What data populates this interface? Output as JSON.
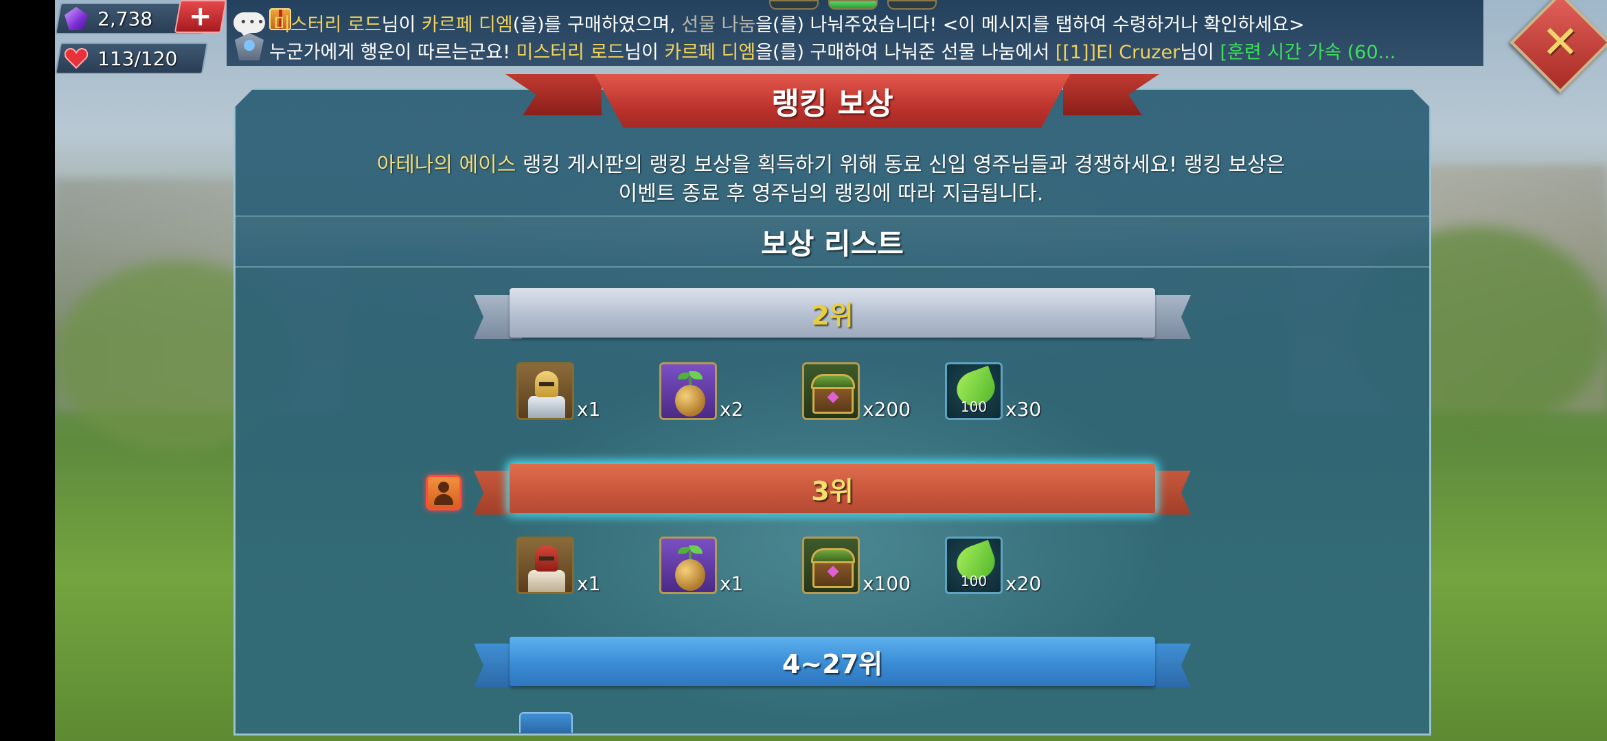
{
  "resources": {
    "gems": "2,738",
    "stamina": "113/120",
    "add_label": "+"
  },
  "notifications": {
    "line1": {
      "seg1": "미스터리 로드",
      "seg2": "님이 ",
      "seg3": "카르페 디엠",
      "seg4": "(을)를 구매하였으며, ",
      "seg5": "선물 나눔",
      "seg6": "을(를) 나눠주었습니다!  <이 메시지를 탭하여 수령하거나 확인하세요>"
    },
    "line2": {
      "seg1": "누군가에게 행운이 따르는군요!  ",
      "seg2": "미스터리 로드",
      "seg3": "님이 ",
      "seg4": "카르페 디엠",
      "seg5": "을(를) 구매하여 나눠준 선물 나눔에서 ",
      "seg6": "[[1]]El Cruzer",
      "seg7": "님이 ",
      "seg8": "[훈련 시간 가속 (60..."
    }
  },
  "close_label": "✕",
  "panel": {
    "title": "랭킹 보상",
    "desc_highlight": "아테나의 에이스",
    "desc_rest1": " 랭킹 게시판의 랭킹 보상을 획득하기 위해 동료 신입 영주님들과 경쟁하세요! 랭킹 보상은",
    "desc_line2": "이벤트 종료 후 영주님의 랭킹에 따라 지급됩니다.",
    "list_header": "보상 리스트"
  },
  "ranks": [
    {
      "label": "2위",
      "rewards": [
        {
          "icon": "gold-knight-icon",
          "qty": "x1"
        },
        {
          "icon": "golden-seed-icon",
          "qty": "x2"
        },
        {
          "icon": "treasure-chest-icon",
          "qty": "x200"
        },
        {
          "icon": "speedup-leaf-icon",
          "icon_text": "100",
          "qty": "x30"
        }
      ]
    },
    {
      "label": "3위",
      "rewards": [
        {
          "icon": "red-knight-icon",
          "qty": "x1"
        },
        {
          "icon": "golden-seed-icon",
          "qty": "x1"
        },
        {
          "icon": "treasure-chest-icon",
          "qty": "x100"
        },
        {
          "icon": "speedup-leaf-icon",
          "icon_text": "100",
          "qty": "x20"
        }
      ]
    },
    {
      "label": "4~27위",
      "rewards": []
    }
  ]
}
